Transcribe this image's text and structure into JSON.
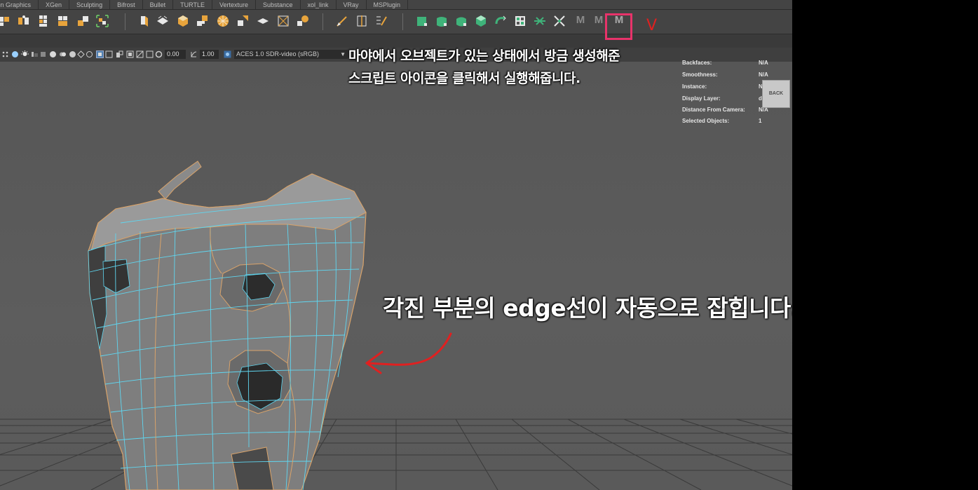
{
  "shelf_tabs": [
    "tion Graphics",
    "XGen",
    "Sculpting",
    "Bifrost",
    "Bullet",
    "TURTLE",
    "Vertexture",
    "Substance",
    "xol_link",
    "VRay",
    "MSPlugin"
  ],
  "shelf": {
    "script_buttons": [
      "M",
      "M",
      "M"
    ],
    "highlighted_button": "M"
  },
  "viewport_toolbar": {
    "exposure": "0.00",
    "gamma": "1.00",
    "color_space": "ACES 1.0 SDR-video (sRGB)"
  },
  "hud": [
    {
      "label": "Backfaces:",
      "value": "N/A"
    },
    {
      "label": "Smoothness:",
      "value": "N/A"
    },
    {
      "label": "Instance:",
      "value": "N/A"
    },
    {
      "label": "Display Layer:",
      "value": "default"
    },
    {
      "label": "Distance From Camera:",
      "value": "N/A"
    },
    {
      "label": "Selected Objects:",
      "value": "1"
    }
  ],
  "viewcube_label": "BACK",
  "annotations": {
    "line1": "마야에서 오브젝트가 있는 상태에서 방금 생성해준",
    "line2": "스크립트 아이콘을 클릭해서 실행해줍니다.",
    "edge_note": "각진 부분의 edge선이 자동으로 잡힙니다.",
    "check_mark": "V"
  },
  "colors": {
    "highlight": "#e8336a",
    "arrow": "#e02020",
    "wire_cyan": "#5fd6f0",
    "wire_orange": "#d9a36a"
  }
}
